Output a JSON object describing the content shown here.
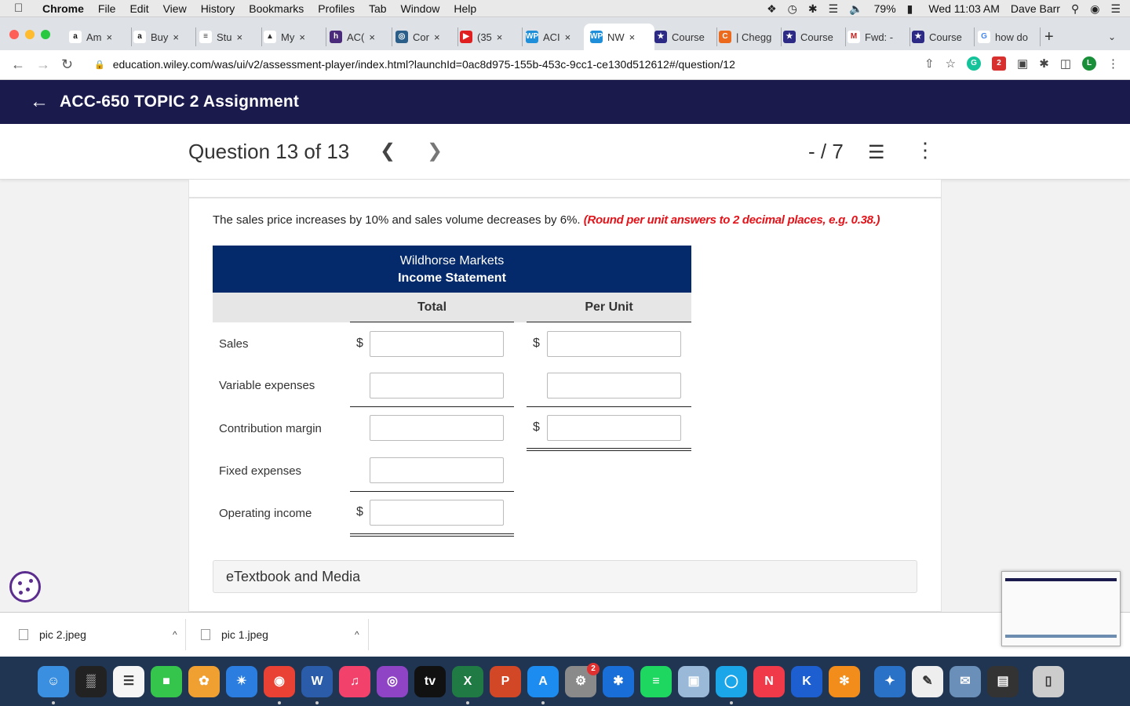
{
  "menubar": {
    "items": [
      "Chrome",
      "File",
      "Edit",
      "View",
      "History",
      "Bookmarks",
      "Profiles",
      "Tab",
      "Window",
      "Help"
    ],
    "battery": "79%",
    "clock": "Wed 11:03 AM",
    "user": "Dave Barr"
  },
  "tabs": [
    {
      "label": "Am",
      "favicon": "amazon-icon",
      "color": "#ffffff"
    },
    {
      "label": "Buy",
      "favicon": "amazon-icon",
      "color": "#ffffff"
    },
    {
      "label": "Stu",
      "favicon": "doc-icon",
      "color": "#ffffff"
    },
    {
      "label": "My",
      "favicon": "book-icon",
      "color": "#ffffff"
    },
    {
      "label": "AC(",
      "favicon": "h-icon",
      "color": "#4a2a7a"
    },
    {
      "label": "Cor",
      "favicon": "globe-icon",
      "color": "#2b5f8a"
    },
    {
      "label": "(35",
      "favicon": "youtube-icon",
      "color": "#e02020"
    },
    {
      "label": "ACI",
      "favicon": "wp-icon",
      "color": "#1e8fd8"
    },
    {
      "label": "NW",
      "favicon": "wp-icon",
      "color": "#1e8fd8"
    },
    {
      "label": "Course",
      "favicon": "star-icon",
      "color": "#2c2a84"
    },
    {
      "label": "| Chegg",
      "favicon": "chegg-icon",
      "color": "#eb6a1e"
    },
    {
      "label": "Course",
      "favicon": "star-icon",
      "color": "#2c2a84"
    },
    {
      "label": "Fwd: -",
      "favicon": "gmail-icon",
      "color": "#ffffff"
    },
    {
      "label": "Course",
      "favicon": "star-icon",
      "color": "#2c2a84"
    },
    {
      "label": "how do",
      "favicon": "google-icon",
      "color": "#ffffff"
    }
  ],
  "address": {
    "url": "education.wiley.com/was/ui/v2/assessment-player/index.html?launchId=0ac8d975-155b-453c-9cc1-ce130d512612#/question/12"
  },
  "app": {
    "title": "ACC-650 TOPIC 2 Assignment"
  },
  "question": {
    "title": "Question 13 of 13",
    "score": "- / 7"
  },
  "content": {
    "instruction": "The sales price increases by 10% and sales volume decreases by 6%.",
    "instruction_note": "(Round per unit answers to 2 decimal places, e.g. 0.38.)",
    "table": {
      "company": "Wildhorse Markets",
      "statement": "Income Statement",
      "col_total": "Total",
      "col_per_unit": "Per Unit",
      "rows": [
        {
          "label": "Sales",
          "total_prefix": "$",
          "unit_prefix": "$"
        },
        {
          "label": "Variable expenses",
          "total_prefix": "",
          "unit_prefix": ""
        },
        {
          "label": "Contribution margin",
          "total_prefix": "",
          "unit_prefix": "$"
        },
        {
          "label": "Fixed expenses",
          "total_prefix": ""
        },
        {
          "label": "Operating income",
          "total_prefix": "$"
        }
      ]
    },
    "etextbook": "eTextbook and Media"
  },
  "downloads": [
    {
      "name": "pic 2.jpeg"
    },
    {
      "name": "pic 1.jpeg"
    }
  ],
  "dock": {
    "notification_badge": "2",
    "apps": [
      {
        "name": "finder-icon",
        "color": "#3b8fe0"
      },
      {
        "name": "activity-icon",
        "color": "#222222"
      },
      {
        "name": "reminders-icon",
        "color": "#f5f5f5"
      },
      {
        "name": "facetime-icon",
        "color": "#35c44c"
      },
      {
        "name": "photos-icon",
        "color": "#f0a030"
      },
      {
        "name": "safari-icon",
        "color": "#2b7ee0"
      },
      {
        "name": "chrome-icon",
        "color": "#e94235"
      },
      {
        "name": "word-icon",
        "color": "#2b5caa"
      },
      {
        "name": "music-icon",
        "color": "#f2416b"
      },
      {
        "name": "podcasts-icon",
        "color": "#8e44c4"
      },
      {
        "name": "tv-icon",
        "color": "#111111"
      },
      {
        "name": "excel-icon",
        "color": "#1f7a44"
      },
      {
        "name": "powerpoint-icon",
        "color": "#d24726"
      },
      {
        "name": "appstore-icon",
        "color": "#1d8cf0"
      },
      {
        "name": "settings-icon",
        "color": "#8a8a8a"
      },
      {
        "name": "bluetooth-icon",
        "color": "#1a6ed8"
      },
      {
        "name": "spotify-icon",
        "color": "#1ed760"
      },
      {
        "name": "preview-icon",
        "color": "#9ab8d8"
      },
      {
        "name": "screen-icon",
        "color": "#1aa6e8"
      },
      {
        "name": "news-icon",
        "color": "#f03a4a"
      },
      {
        "name": "keynote-icon",
        "color": "#1d5fd1"
      },
      {
        "name": "flower-icon",
        "color": "#f28c1a"
      },
      {
        "name": "network-icon",
        "color": "#2a72c8"
      },
      {
        "name": "textedit-icon",
        "color": "#eeeeee"
      },
      {
        "name": "mail-icon",
        "color": "#6a8fb8"
      },
      {
        "name": "printer-icon",
        "color": "#333333"
      },
      {
        "name": "trash-icon",
        "color": "#cccccc"
      }
    ]
  }
}
